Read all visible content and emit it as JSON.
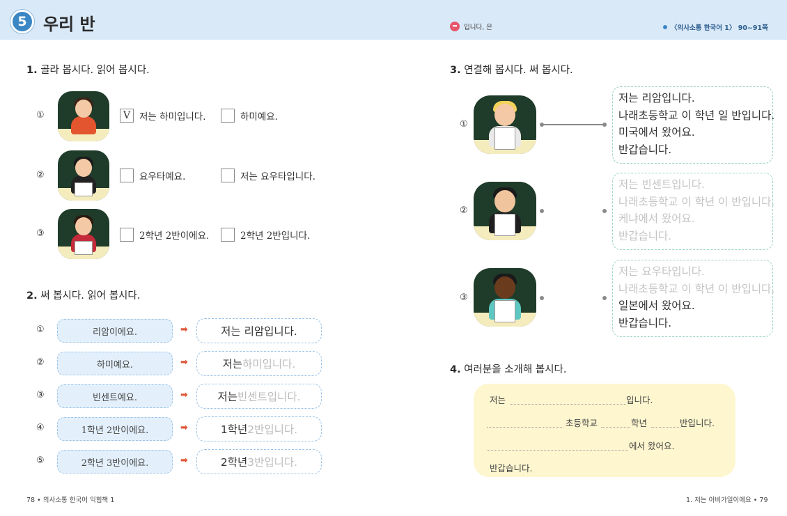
{
  "header": {
    "unit_number": "5",
    "unit_title": "우리 반",
    "grammar": "입니다, 은",
    "reference": "〈의사소통 한국어 1〉 90~91쪽"
  },
  "section1": {
    "title_num": "1.",
    "title": "골라 봅시다. 읽어 봅시다.",
    "rows": [
      {
        "num": "①",
        "opt1": "저는 하미입니다.",
        "opt1_checked": "V",
        "opt2": "하미예요."
      },
      {
        "num": "②",
        "opt1": "요우타예요.",
        "opt1_checked": "",
        "opt2": "저는 요우타입니다."
      },
      {
        "num": "③",
        "opt1": "2학년 2반이에요.",
        "opt1_checked": "",
        "opt2": "2학년 2반입니다."
      }
    ]
  },
  "section2": {
    "title_num": "2.",
    "title": "써 봅시다. 읽어 봅시다.",
    "arrow": "➡",
    "rows": [
      {
        "num": "①",
        "src": "리암이에요.",
        "dst_solid": "저는 리암입니다.",
        "dst_trace": ""
      },
      {
        "num": "②",
        "src": "하미예요.",
        "dst_solid": "저는 ",
        "dst_trace": "하미입니다."
      },
      {
        "num": "③",
        "src": "빈센트예요.",
        "dst_solid": "저는 ",
        "dst_trace": "빈센트입니다."
      },
      {
        "num": "④",
        "src": "1학년 2반이에요.",
        "dst_solid": "1학년 ",
        "dst_trace": "2반입니다."
      },
      {
        "num": "⑤",
        "src": "2학년 3반이에요.",
        "dst_solid": "2학년 ",
        "dst_trace": "3반입니다."
      }
    ]
  },
  "section3": {
    "title_num": "3.",
    "title": "연결해 봅시다. 써 봅시다.",
    "rows": [
      {
        "num": "①",
        "lines": [
          "저는 리암입니다.",
          "나래초등학교 이 학년 일 반입니다.",
          "미국에서 왔어요.",
          "반갑습니다."
        ],
        "traced": [
          false,
          false,
          false,
          false
        ]
      },
      {
        "num": "②",
        "lines": [
          "저는 빈센트입니다.",
          "나래초등학교 이 학년 이 반입니다.",
          "케냐에서 왔어요.",
          "반갑습니다."
        ],
        "traced": [
          true,
          true,
          true,
          true
        ]
      },
      {
        "num": "③",
        "lines": [
          "저는 요우타입니다.",
          "나래초등학교 이 학년 이 반입니다.",
          "일본에서 왔어요.",
          "반갑습니다."
        ],
        "traced": [
          true,
          true,
          false,
          false
        ]
      }
    ]
  },
  "section4": {
    "title_num": "4.",
    "title": "여러분을 소개해 봅시다.",
    "line1_a": "저는",
    "line1_b": "입니다.",
    "line2_a": "초등학교",
    "line2_b": "학년",
    "line2_c": "반입니다.",
    "line3": "에서 왔어요.",
    "line4": "반갑습니다."
  },
  "footer": {
    "left": "78 • 의사소통 한국어 익힘책 1",
    "right": "1. 저는 아비가일이에요 • 79"
  },
  "colors": {
    "header_bg": "#d9e9f8",
    "unit_circle": "#3b86c4",
    "arrow": "#e05a3c",
    "intro_card": "#fdf6cf"
  },
  "icons": [
    "grammar-icon",
    "reference-dot-icon",
    "right-arrow-icon",
    "check-mark-icon"
  ]
}
